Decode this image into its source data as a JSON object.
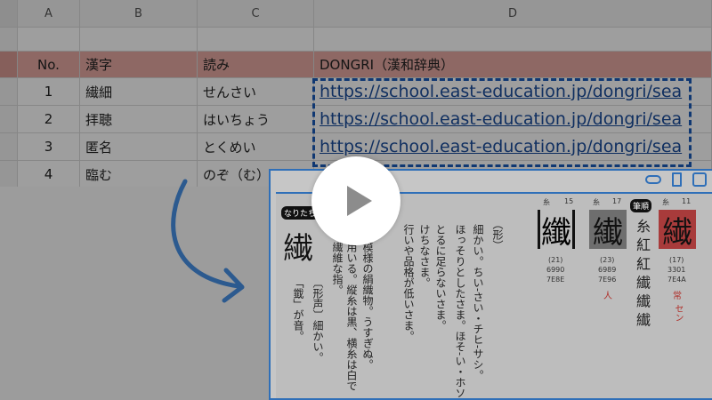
{
  "sheet": {
    "columns": [
      "A",
      "B",
      "C",
      "D"
    ],
    "title_row": {
      "a": "No.",
      "b": "漢字",
      "c": "読み",
      "d": "DONGRI（漢和辞典）"
    },
    "rows": [
      {
        "a": "1",
        "b": "繊細",
        "c": "せんさい",
        "d": "https://school.east-education.jp/dongri/sea"
      },
      {
        "a": "2",
        "b": "拝聴",
        "c": "はいちょう",
        "d": "https://school.east-education.jp/dongri/sea"
      },
      {
        "a": "3",
        "b": "匿名",
        "c": "とくめい",
        "d": "https://school.east-education.jp/dongri/sea"
      },
      {
        "a": "4",
        "b": "臨む",
        "c": "のぞ（む）",
        "d": ""
      }
    ]
  },
  "dict": {
    "badge_naritachi": "なりたち",
    "main_kanji": "繊",
    "text_col1": "性の繊維な指。",
    "text_col2": "服に用いる。縦糸は黒、横糸は白で",
    "text_col3": "かい模様の絹織物。うすぎぬ。",
    "text_col4": "行いや品格が低いさま。",
    "text_col5": "けちなさま。",
    "text_col6": "とるに足らないさま。",
    "text_col7": "ほっそりとしたさま。ほそ-い・ホソ-",
    "text_col8": "細かい。ちい-さい・チヒ-サシ。",
    "text_col9": "（形）",
    "note_a": "「韱」が音。",
    "note_b": "〔形声〕細かい。",
    "kanji_boxes": [
      {
        "kanji": "纖",
        "radical": "糸",
        "strokes": "15",
        "code1": "(21)",
        "code2": "6990",
        "code3": "7E8E"
      },
      {
        "kanji": "纎",
        "radical": "糸",
        "strokes": "17",
        "code1": "(23)",
        "code2": "6989",
        "code3": "7E96"
      },
      {
        "kanji": "繊",
        "radical": "糸",
        "strokes": "11",
        "code1": "(17)",
        "code2": "3301",
        "code3": "7E4A"
      }
    ],
    "reading_label": "セン",
    "label_hitsujun": "筆順",
    "label_hito": "人",
    "label_joyo": "常"
  }
}
